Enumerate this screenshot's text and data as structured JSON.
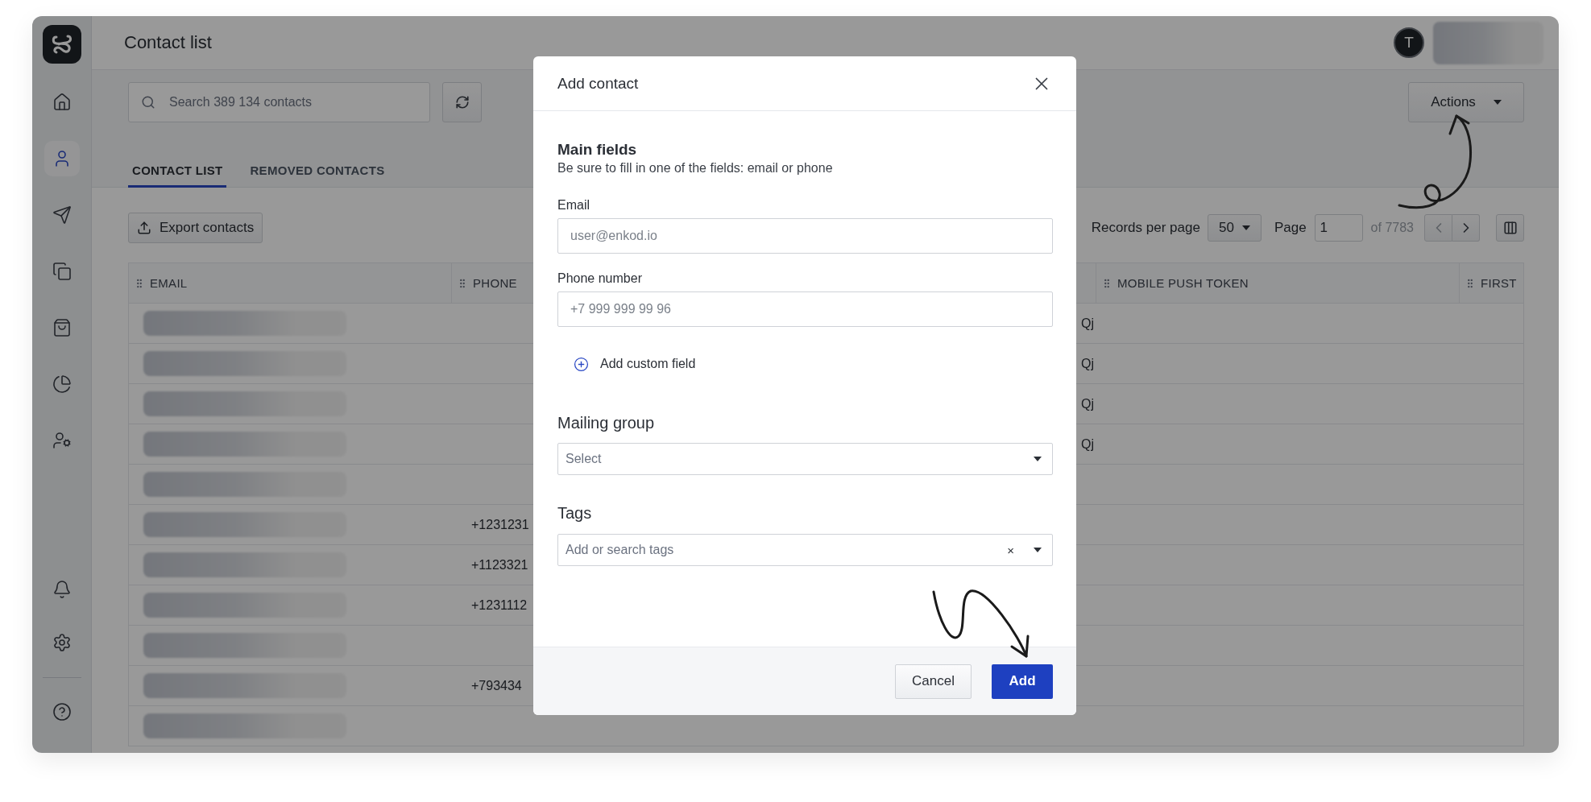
{
  "sidebar": {
    "items": [
      {
        "selected": false
      },
      {
        "selected": true
      },
      {
        "selected": false
      },
      {
        "selected": false
      },
      {
        "selected": false
      },
      {
        "selected": false
      },
      {
        "selected": false
      }
    ],
    "footer_items": [
      {
        "selected": false
      },
      {
        "selected": false
      },
      {
        "selected": false
      }
    ]
  },
  "header": {
    "title": "Contact list",
    "avatar": "T"
  },
  "toolbar": {
    "search": {
      "placeholder": "Search 389 134 contacts"
    },
    "actions": "Actions"
  },
  "tabs": [
    {
      "label": "CONTACT LIST",
      "selected": true
    },
    {
      "label": "REMOVED CONTACTS",
      "selected": false
    }
  ],
  "export_button": "Export contacts",
  "pagination": {
    "records_label": "Records per page",
    "per_page": "50",
    "page_label": "Page",
    "page": "1",
    "total": "of 7783"
  },
  "table": {
    "columns": [
      {
        "label": "EMAIL",
        "kind": "redacted"
      },
      {
        "label": "PHONE",
        "kind": "text"
      },
      {
        "kind": "text"
      },
      {
        "label": "MOBILE PUSH TOKEN",
        "kind": "text"
      },
      {
        "label": "FIRST",
        "kind": "text"
      }
    ],
    "rows": [
      {
        "column_3": "Qj"
      },
      {
        "column_3": "Qj"
      },
      {
        "column_3": "Qj"
      },
      {
        "column_3": "Qj"
      },
      {},
      {
        "phone": "+1231231"
      },
      {
        "phone": "+1123321"
      },
      {
        "phone": "+1231112"
      },
      {},
      {
        "phone": "+793434"
      },
      {}
    ]
  },
  "modal": {
    "title": "Add contact",
    "section_title": "Main fields",
    "section_hint": "Be sure to fill in one of the fields: email or phone",
    "fields": [
      {
        "label": "Email",
        "placeholder": "user@enkod.io"
      },
      {
        "label": "Phone number",
        "placeholder": "+7 999 999 99 96"
      }
    ],
    "add_custom_field": "Add custom field",
    "mailing_group": {
      "label": "Mailing group",
      "placeholder": "Select"
    },
    "tags": {
      "label": "Tags",
      "placeholder": "Add or search tags",
      "clear": "×"
    },
    "buttons": {
      "cancel": "Cancel",
      "submit": "Add"
    }
  }
}
